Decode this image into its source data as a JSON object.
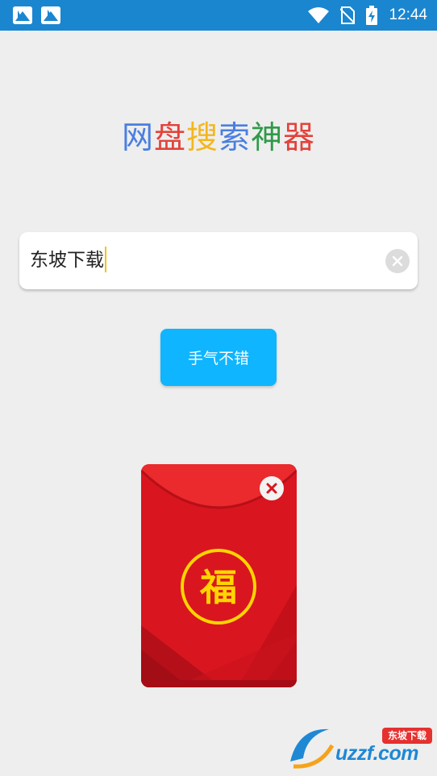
{
  "status_bar": {
    "time": "12:44",
    "icons": [
      "app-notification-icon",
      "app-notification-icon",
      "wifi-icon",
      "no-sim-icon",
      "battery-charging-icon"
    ]
  },
  "title": {
    "chars": [
      {
        "char": "网",
        "color": "#4a7fe0"
      },
      {
        "char": "盘",
        "color": "#e2433b"
      },
      {
        "char": "搜",
        "color": "#f3b61f"
      },
      {
        "char": "索",
        "color": "#4a7fe0"
      },
      {
        "char": "神",
        "color": "#2f9a49"
      },
      {
        "char": "器",
        "color": "#e2433b"
      }
    ]
  },
  "search": {
    "value": "东坡下载",
    "clear_icon": "clear-icon"
  },
  "submit_button": {
    "label": "手气不错",
    "color": "#0fb5ff"
  },
  "red_envelope": {
    "character": "福",
    "close_icon": "close-icon",
    "color": "#e01f26",
    "emblem_color": "#ffd500"
  },
  "watermark": {
    "site": "uzzf.com",
    "badge": "东坡下载"
  }
}
